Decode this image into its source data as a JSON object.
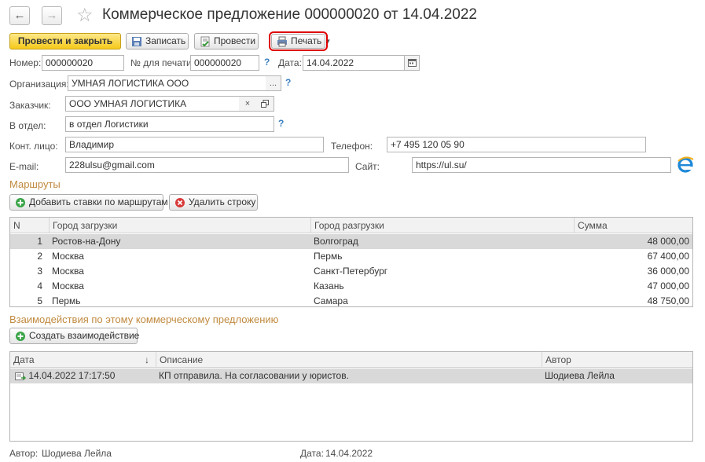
{
  "window": {
    "title": "Коммерческое предложение 000000020 от 14.04.2022",
    "nav_back": "←",
    "nav_forward": "→",
    "favorite_glyph": "☆"
  },
  "toolbar": {
    "post_close_label": "Провести и закрыть",
    "save_label": "Записать",
    "post_label": "Провести",
    "print_label": "Печать"
  },
  "form": {
    "number_label": "Номер:",
    "number_value": "000000020",
    "print_number_label": "№ для печати:",
    "print_number_value": "000000020",
    "date_label": "Дата:",
    "date_value": "14.04.2022",
    "org_label": "Организация:",
    "org_value": "УМНАЯ ЛОГИСТИКА ООО",
    "customer_label": "Заказчик:",
    "customer_value": "ООО УМНАЯ ЛОГИСТИКА",
    "dept_label": "В отдел:",
    "dept_value": "в отдел Логистики",
    "contact_label": "Конт. лицо:",
    "contact_value": "Владимир",
    "phone_label": "Телефон:",
    "phone_value": "+7 495 120 05 90",
    "email_label": "E-mail:",
    "email_value": "228ulsu@gmail.com",
    "site_label": "Сайт:",
    "site_value": "https://ul.su/",
    "help_glyph": "?",
    "ellipsis": "...",
    "clear_glyph": "×"
  },
  "routes": {
    "section_title": "Маршруты",
    "add_rates_label": "Добавить ставки по маршрутам",
    "delete_row_label": "Удалить строку",
    "columns": [
      "N",
      "Город загрузки",
      "Город разгрузки",
      "Сумма"
    ],
    "rows": [
      {
        "n": "1",
        "from": "Ростов-на-Дону",
        "to": "Волгоград",
        "sum": "48 000,00"
      },
      {
        "n": "2",
        "from": "Москва",
        "to": "Пермь",
        "sum": "67 400,00"
      },
      {
        "n": "3",
        "from": "Москва",
        "to": "Санкт-Петербург",
        "sum": "36 000,00"
      },
      {
        "n": "4",
        "from": "Москва",
        "to": "Казань",
        "sum": "47 000,00"
      },
      {
        "n": "5",
        "from": "Пермь",
        "to": "Самара",
        "sum": "48 750,00"
      }
    ]
  },
  "interactions": {
    "section_title": "Взаимодействия по этому коммерческому предложению",
    "create_label": "Создать взаимодействие",
    "columns": [
      "Дата",
      "Описание",
      "Автор"
    ],
    "sort_glyph": "↓",
    "rows": [
      {
        "date": "14.04.2022 17:17:50",
        "description": "КП отправила. На согласовании у юристов.",
        "author": "Шодиева Лейла"
      }
    ]
  },
  "footer": {
    "author_label": "Автор:",
    "author_value": "Шодиева Лейла",
    "date_label": "Дата:",
    "date_value": "14.04.2022"
  },
  "colors": {
    "primary_button": "#f5c919",
    "section_title": "#c08a3f",
    "selected_row": "#d9d9d9",
    "help": "#3a7fc2",
    "print_highlight": "#e00000"
  }
}
